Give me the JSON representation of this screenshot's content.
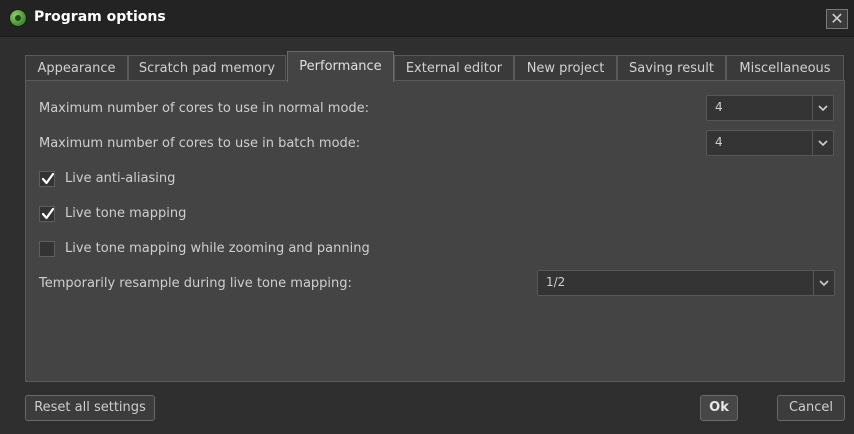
{
  "window": {
    "title": "Program options",
    "close_glyph": "✕"
  },
  "tabs": [
    {
      "label": "Appearance",
      "active": false
    },
    {
      "label": "Scratch pad memory",
      "active": false
    },
    {
      "label": "Performance",
      "active": true
    },
    {
      "label": "External editor",
      "active": false
    },
    {
      "label": "New project",
      "active": false
    },
    {
      "label": "Saving result",
      "active": false
    },
    {
      "label": "Miscellaneous",
      "active": false
    }
  ],
  "performance": {
    "cores_normal": {
      "label": "Maximum number of cores to use in normal mode:",
      "value": "4"
    },
    "cores_batch": {
      "label": "Maximum number of cores to use in batch mode:",
      "value": "4"
    },
    "live_antialiasing": {
      "label": "Live anti-aliasing",
      "checked": true
    },
    "live_tone_mapping": {
      "label": "Live tone mapping",
      "checked": true
    },
    "live_tone_mapping_zoom": {
      "label": "Live tone mapping while zooming and panning",
      "checked": false
    },
    "resample": {
      "label": "Temporarily resample during live tone mapping:",
      "value": "1/2"
    }
  },
  "footer": {
    "reset_label": "Reset all settings",
    "ok_label": "Ok",
    "cancel_label": "Cancel"
  },
  "icons": {
    "app": "app-icon",
    "close": "close-icon",
    "dropdown": "chevron-down-icon",
    "check": "checkmark-icon"
  }
}
